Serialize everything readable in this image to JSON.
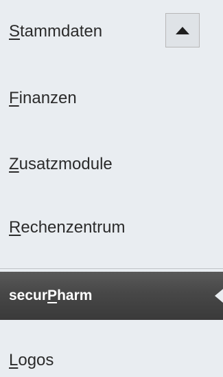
{
  "menu": {
    "items": [
      {
        "pre": "",
        "key": "S",
        "post": "tammdaten",
        "active": false
      },
      {
        "pre": "",
        "key": "F",
        "post": "inanzen",
        "active": false
      },
      {
        "pre": "",
        "key": "Z",
        "post": "usatzmodule",
        "active": false
      },
      {
        "pre": "",
        "key": "R",
        "post": "echenzentrum",
        "active": false
      },
      {
        "pre": "secur",
        "key": "P",
        "post": "harm",
        "active": true
      },
      {
        "pre": "",
        "key": "L",
        "post": "ogos",
        "active": false
      }
    ]
  },
  "icons": {
    "scroll_up": "triangle-up-icon",
    "active_pointer": "triangle-left-icon"
  },
  "colors": {
    "background": "#e9edf1",
    "active_bg": "#474747",
    "active_text": "#ffffff",
    "text": "#2b2b2b"
  }
}
